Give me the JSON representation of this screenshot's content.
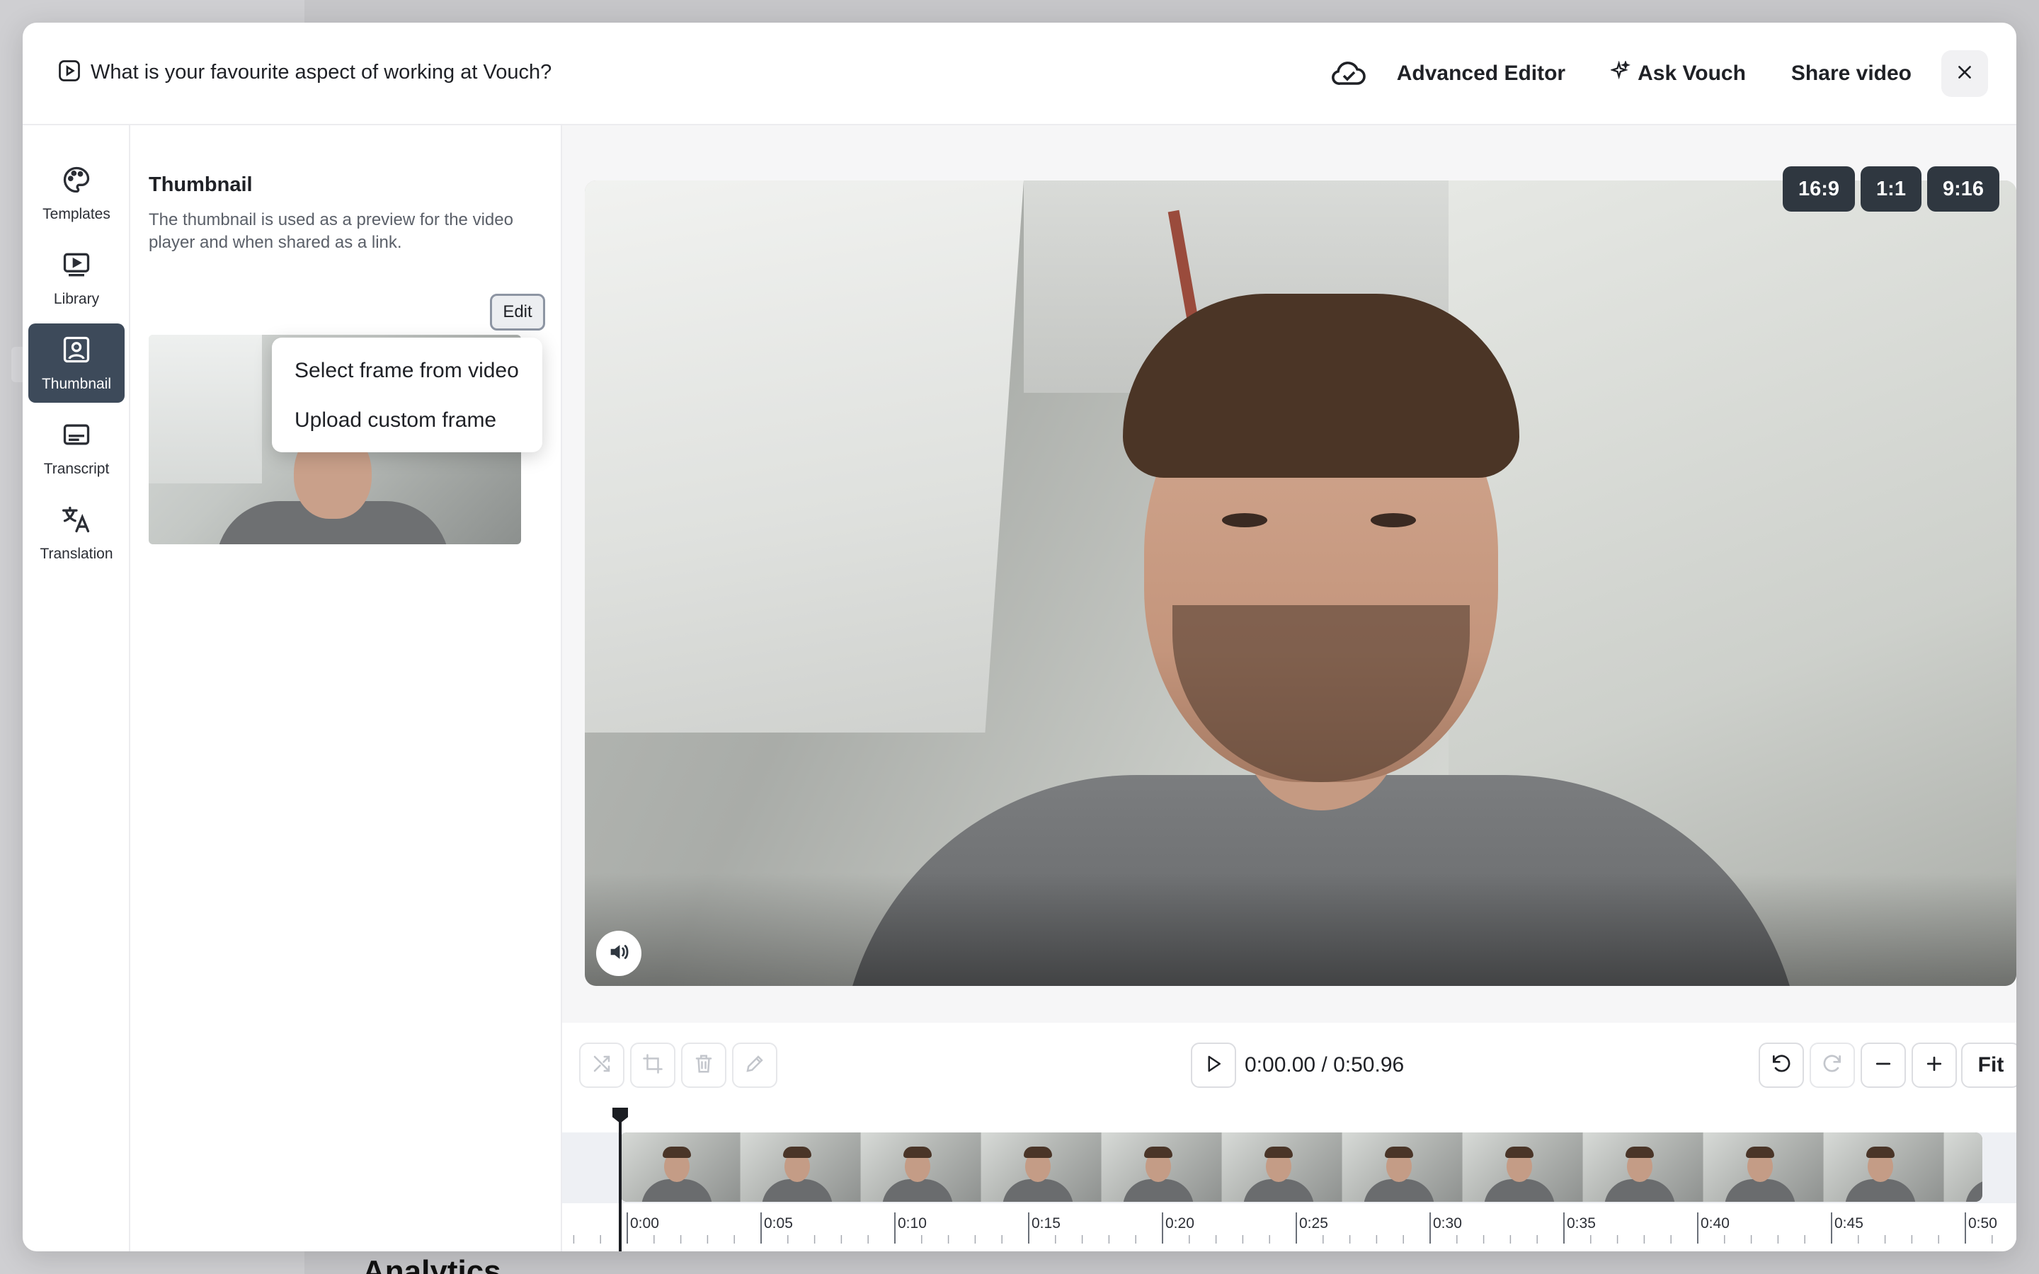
{
  "header": {
    "title": "What is your favourite aspect of working at Vouch?",
    "advanced_editor": "Advanced Editor",
    "ask_vouch": "Ask Vouch",
    "share_video": "Share video"
  },
  "rail": {
    "items": [
      {
        "label": "Templates",
        "icon": "palette-icon"
      },
      {
        "label": "Library",
        "icon": "video-library-icon"
      },
      {
        "label": "Thumbnail",
        "icon": "portrait-icon",
        "active": true
      },
      {
        "label": "Transcript",
        "icon": "subtitles-icon"
      },
      {
        "label": "Translation",
        "icon": "translate-icon"
      }
    ]
  },
  "panel": {
    "title": "Thumbnail",
    "description": "The thumbnail is used as a preview for the video player and when shared as a link.",
    "edit_label": "Edit",
    "menu": {
      "select_frame": "Select frame from video",
      "upload_frame": "Upload custom frame"
    }
  },
  "aspect_ratios": [
    "16:9",
    "1:1",
    "9:16"
  ],
  "player": {
    "timecode": "0:00.00 / 0:50.96",
    "fit_label": "Fit"
  },
  "timeline": {
    "ticks": [
      "0:00",
      "0:05",
      "0:10",
      "0:15",
      "0:20",
      "0:25",
      "0:30",
      "0:35",
      "0:40",
      "0:45",
      "0:50"
    ]
  },
  "background": {
    "heading": "Analytics"
  },
  "colors": {
    "active_rail": "#3d4a5a",
    "ratio_chip": "#2f3740"
  }
}
